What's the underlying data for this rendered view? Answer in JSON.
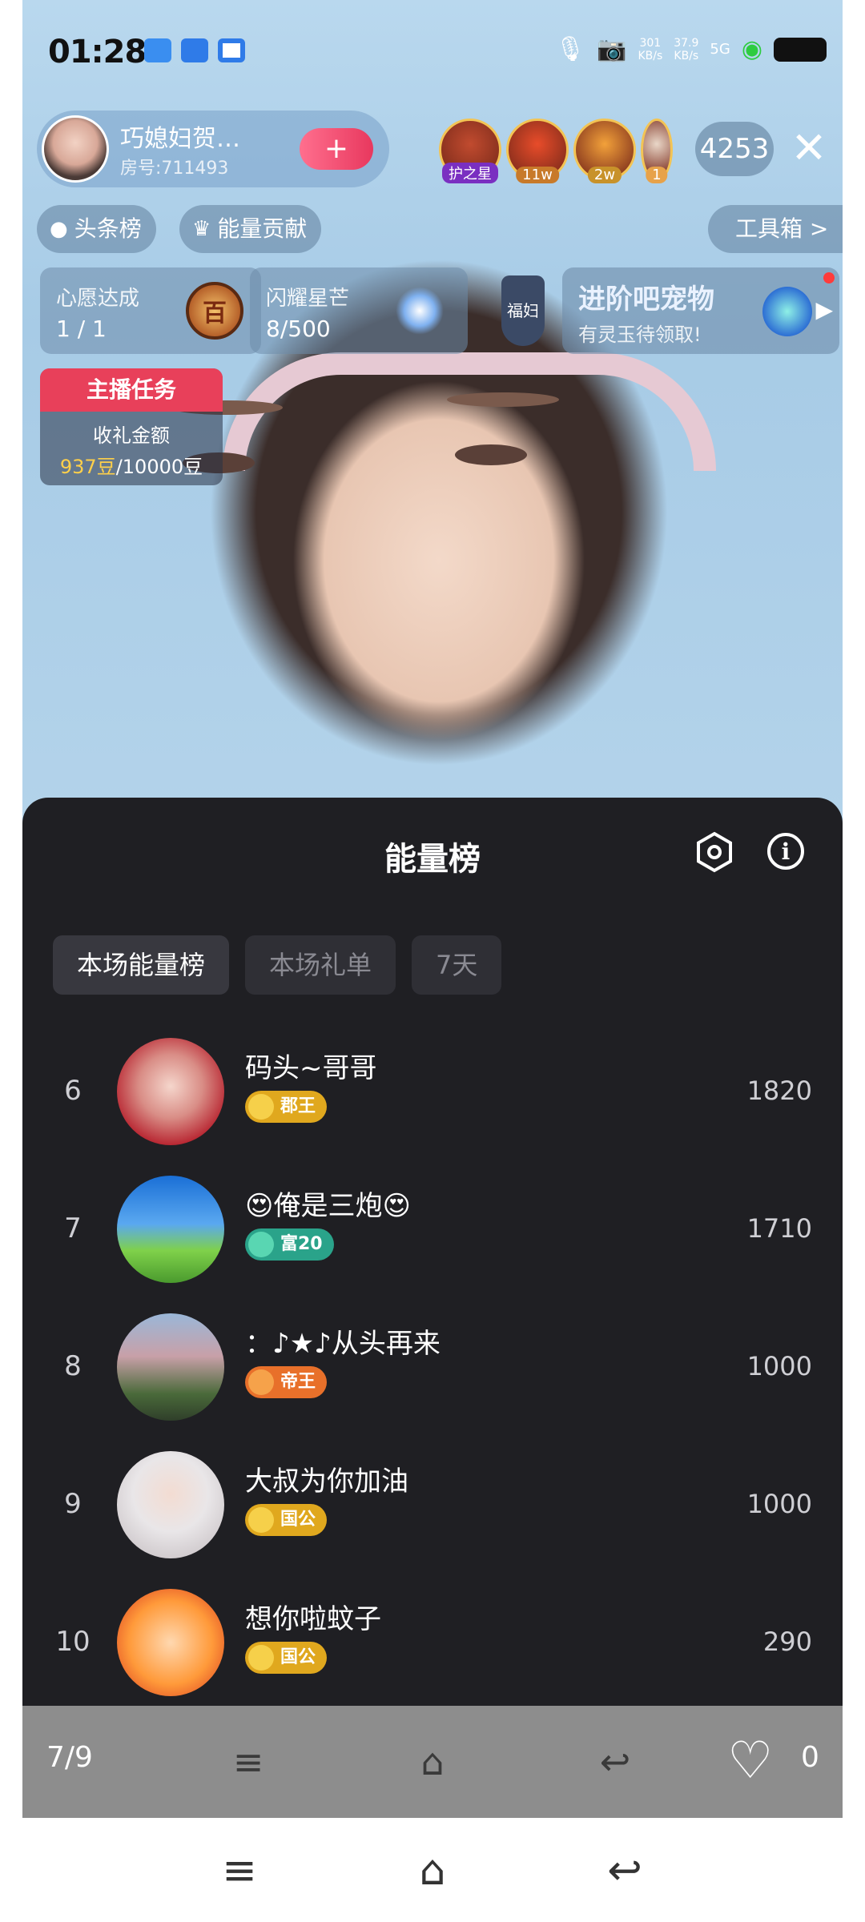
{
  "status_bar": {
    "time": "01:28",
    "net_up": "301\nKB/s",
    "net_down": "37.9\nKB/s",
    "signal": "5G"
  },
  "host": {
    "name": "巧媳妇贺…",
    "room": "房号:711493",
    "follow_label": "+"
  },
  "viewers": [
    {
      "tag": "护之星",
      "color": "#c14b2f",
      "tag_bg": "#7a2fc1"
    },
    {
      "tag": "11w",
      "color": "#e84c2a",
      "tag_bg": "#c87a2a"
    },
    {
      "tag": "2w",
      "color": "#f2a13a",
      "tag_bg": "#c8922a"
    },
    {
      "tag": "1",
      "color": "#e9d7c8",
      "tag_bg": "#e7a24a"
    }
  ],
  "viewer_count": "4253",
  "top_pills": {
    "headline": "头条榜",
    "energy": "能量贡献",
    "toolbox": "工具箱 >"
  },
  "cards": {
    "wish": {
      "title": "心愿达成",
      "value": "1 / 1",
      "medal": "百"
    },
    "star": {
      "title": "闪耀星芒",
      "value": "8/500"
    },
    "shield": "福妇",
    "promo": {
      "title": "进阶吧宠物",
      "subtitle": "有灵玉待领取!"
    }
  },
  "task": {
    "header": "主播任务",
    "label": "收礼金额",
    "current": "937豆",
    "target": "/10000豆"
  },
  "sheet": {
    "title": "能量榜",
    "tabs": [
      "本场能量榜",
      "本场礼单",
      "7天"
    ]
  },
  "ranking": [
    {
      "rank": "6",
      "name": "码头~哥哥",
      "badge": "郡王",
      "badge_color": "#e0a81e",
      "dot_color": "#f6d04a",
      "score": "1820",
      "avatar_bg": "radial-gradient(circle at 50% 45%, #f5d6cc 0%, #d98d86 40%, #b7232f 75%)"
    },
    {
      "rank": "7",
      "name": "😍俺是三炮😍",
      "badge": "富20",
      "badge_color": "#2aa38a",
      "dot_color": "#59d6b2",
      "score": "1710",
      "avatar_bg": "linear-gradient(180deg,#1a6fd6 0%,#5aa8f0 45%,#7fd14a 70%,#4a9a2e 100%)"
    },
    {
      "rank": "8",
      "name": "：♪★♪从头再来",
      "badge": "帝王",
      "badge_color": "#e8702a",
      "dot_color": "#f6a24a",
      "score": "1000",
      "avatar_bg": "linear-gradient(180deg,#9ab7d8 0%,#c8a0a8 40%,#4a6a3a 75%,#2f3f2a 100%)"
    },
    {
      "rank": "9",
      "name": "大叔为你加油",
      "badge": "国公",
      "badge_color": "#e0a81e",
      "dot_color": "#f6d04a",
      "score": "1000",
      "avatar_bg": "radial-gradient(circle at 50% 40%, #f3dcd2 0%, #e9e6e8 45%, #cfc9cc 80%)"
    },
    {
      "rank": "10",
      "name": "想你啦蚊子",
      "badge": "国公",
      "badge_color": "#e0a81e",
      "dot_color": "#f6d04a",
      "score": "290",
      "avatar_bg": "radial-gradient(circle at 50% 50%, #ffd8b0 0%, #ff9a3a 55%, #e8602a 80%)"
    }
  ],
  "navbar": {
    "page_indicator": "7/9",
    "likes": "0"
  }
}
